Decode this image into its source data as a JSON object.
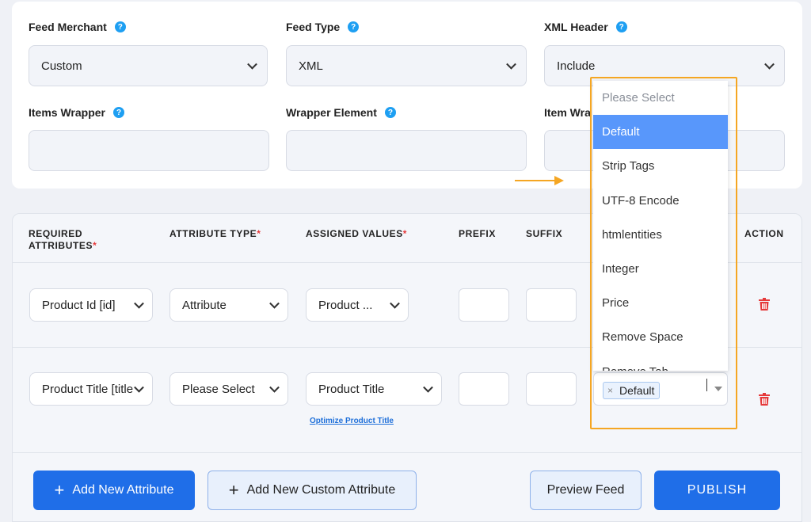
{
  "settings": {
    "feed_merchant": {
      "label": "Feed Merchant",
      "value": "Custom"
    },
    "feed_type": {
      "label": "Feed Type",
      "value": "XML"
    },
    "xml_header": {
      "label": "XML Header",
      "value": "Include"
    },
    "items_wrapper": {
      "label": "Items Wrapper",
      "value": ""
    },
    "wrapper_element": {
      "label": "Wrapper Element",
      "value": ""
    },
    "item_wrapper": {
      "label": "Item Wra",
      "value": ""
    },
    "help_glyph": "?"
  },
  "table": {
    "headers": {
      "required_attributes_line1": "REQUIRED",
      "required_attributes_line2": "ATTRIBUTES",
      "attribute_type": "ATTRIBUTE TYPE",
      "assigned_values": "ASSIGNED VALUES",
      "prefix": "PREFIX",
      "suffix": "SUFFIX",
      "action": "ACTION",
      "required_mark": "*"
    },
    "rows": [
      {
        "attribute": "Product Id [id]",
        "type": "Attribute",
        "value": "Product ...",
        "prefix": "",
        "suffix": ""
      },
      {
        "attribute": "Product Title [title",
        "type": "Please Select",
        "value": "Product Title",
        "prefix": "",
        "suffix": "",
        "link": "Optimize Product Title",
        "output_tag": "Default"
      }
    ]
  },
  "dropdown": {
    "items": [
      "Please Select",
      "Default",
      "Strip Tags",
      "UTF-8 Encode",
      "htmlentities",
      "Integer",
      "Price",
      "Remove Space",
      "Remove Tab"
    ],
    "selected": "Default",
    "tag_remove": "×"
  },
  "buttons": {
    "add_attribute": "Add New Attribute",
    "add_custom_attribute": "Add New Custom Attribute",
    "preview": "Preview Feed",
    "publish": "PUBLISH",
    "plus": "+"
  },
  "colors": {
    "primary": "#1f6ee8",
    "highlight": "#f5a623",
    "danger": "#e5393a",
    "help": "#1e9ff2"
  }
}
